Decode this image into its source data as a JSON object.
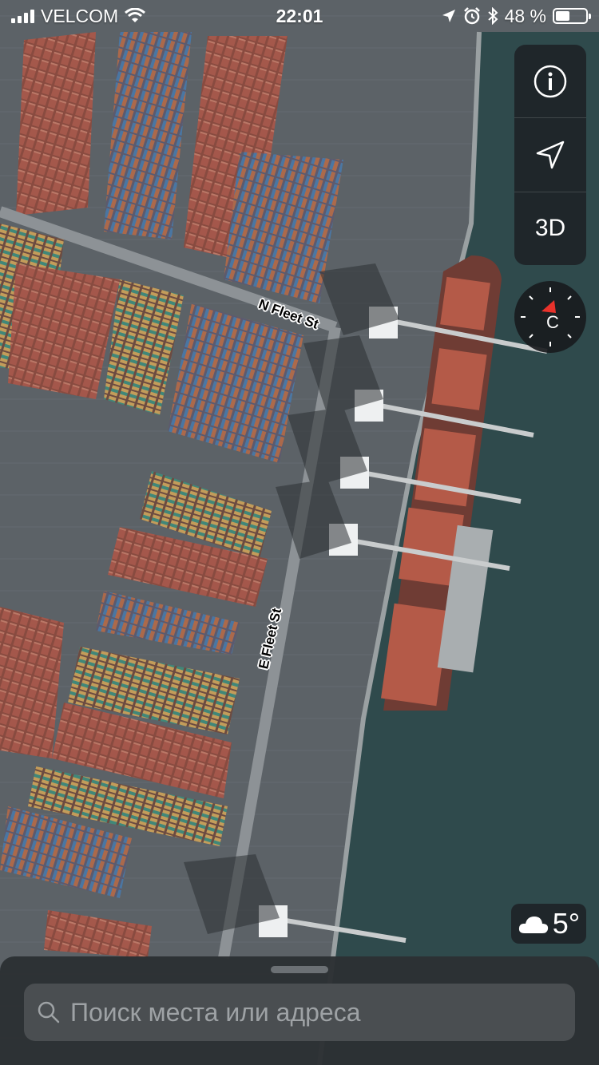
{
  "status": {
    "carrier": "VELCOM",
    "time": "22:01",
    "battery": "48 %",
    "battery_level": 0.48
  },
  "map": {
    "roads": [
      "N Fleet St",
      "E Fleet St"
    ]
  },
  "controls": {
    "info_icon": "info-icon",
    "location_icon": "location-arrow-icon",
    "mode_3d": "3D",
    "compass_letter": "С"
  },
  "weather": {
    "icon": "cloud-icon",
    "temperature": "5°"
  },
  "search": {
    "placeholder": "Поиск места или адреса"
  },
  "colors": {
    "water": "#2f4a4c",
    "accent_red": "#e8322b"
  }
}
